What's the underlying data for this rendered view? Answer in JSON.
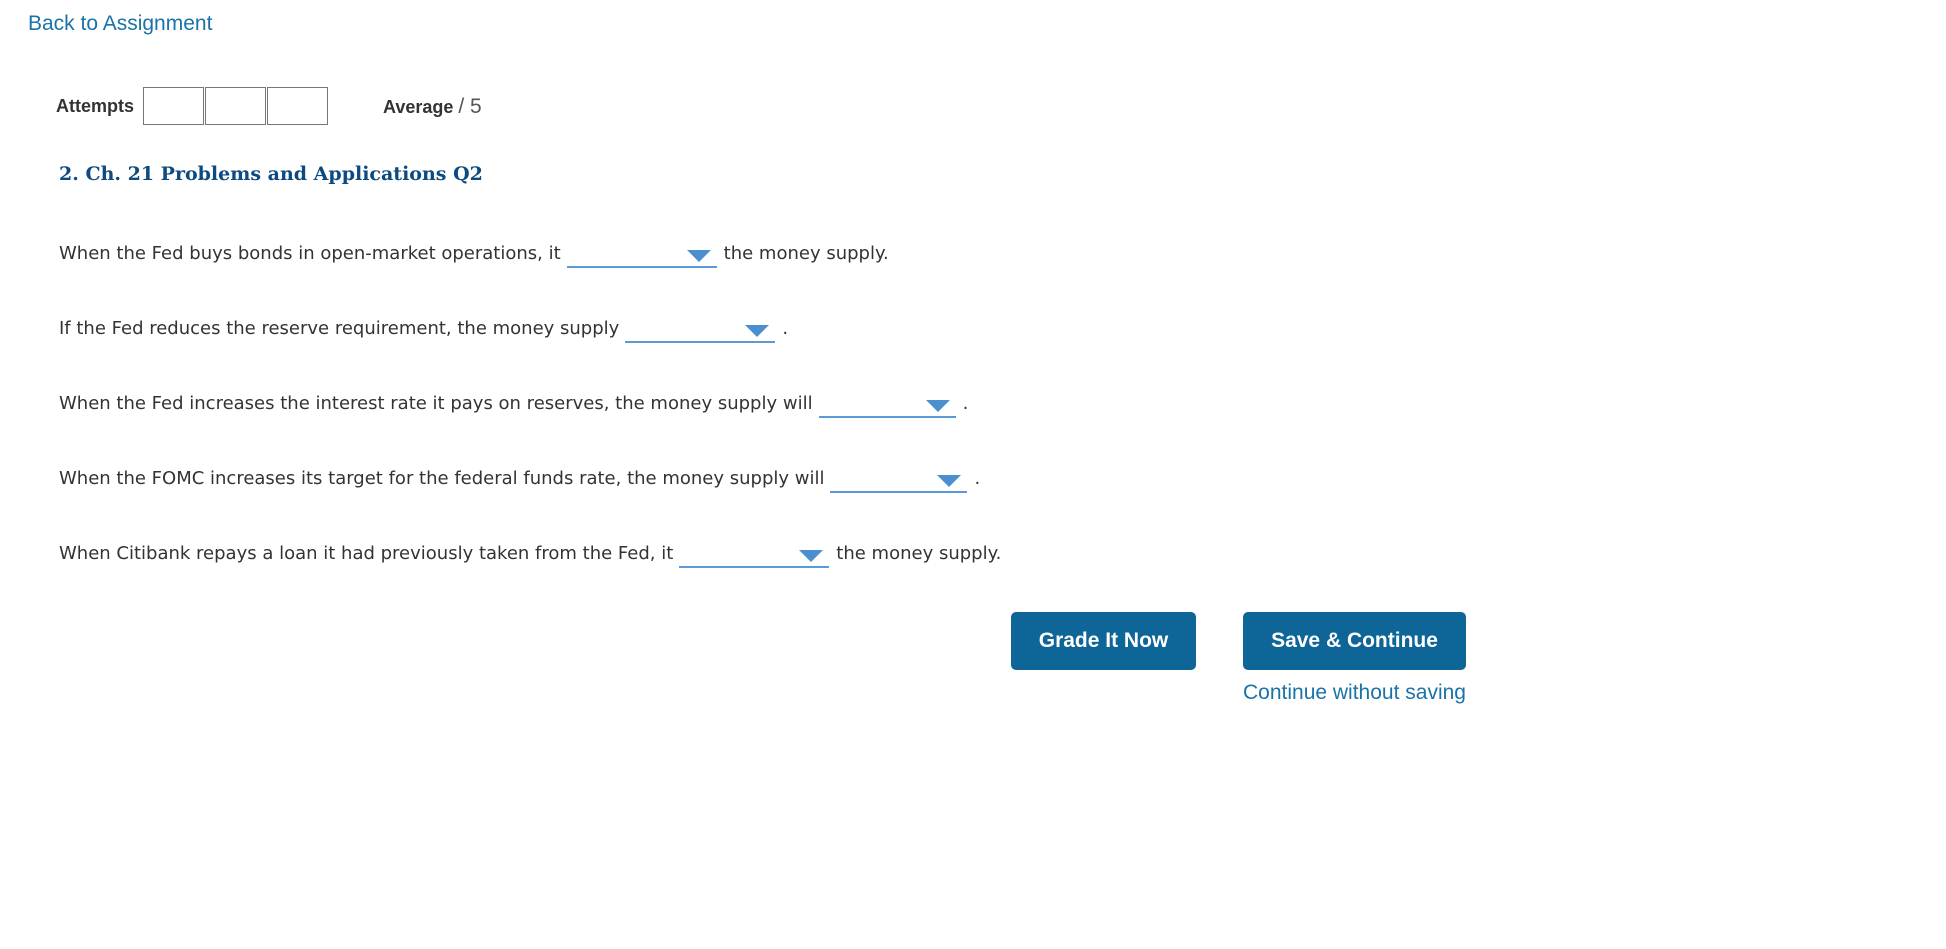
{
  "nav": {
    "back_label": "Back to Assignment"
  },
  "attempts": {
    "label": "Attempts",
    "boxes": [
      "",
      "",
      ""
    ]
  },
  "average": {
    "label": "Average",
    "score": "/ 5"
  },
  "question": {
    "title": "2. Ch. 21 Problems and Applications Q2",
    "statements": [
      {
        "before": "When the Fed buys bonds in open-market operations, it",
        "after": "the money supply."
      },
      {
        "before": "If the Fed reduces the reserve requirement, the money supply",
        "after": "."
      },
      {
        "before": "When the Fed increases the interest rate it pays on reserves, the money supply will",
        "after": "."
      },
      {
        "before": "When the FOMC increases its target for the federal funds rate, the money supply will",
        "after": "."
      },
      {
        "before": "When Citibank repays a loan it had previously taken from the Fed, it",
        "after": "the money supply."
      }
    ]
  },
  "actions": {
    "grade_label": "Grade It Now",
    "save_label": "Save & Continue",
    "continue_label": "Continue without saving"
  },
  "colors": {
    "link": "#1a73a8",
    "button": "#0d6598",
    "title": "#0d4a80",
    "dropdown_accent": "#5b9bd5"
  },
  "icons": {
    "dropdown": "caret-down-icon"
  }
}
